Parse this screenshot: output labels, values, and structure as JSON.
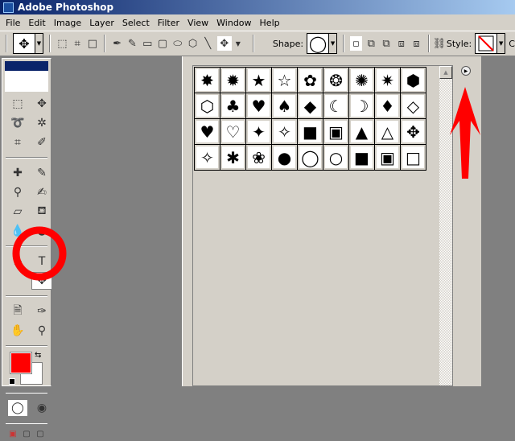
{
  "title": "Adobe Photoshop",
  "menu": [
    "File",
    "Edit",
    "Image",
    "Layer",
    "Select",
    "Filter",
    "View",
    "Window",
    "Help"
  ],
  "options": {
    "shape_label": "Shape:",
    "style_label": "Style:",
    "tail": "C"
  },
  "shapes": [
    "✸",
    "✹",
    "★",
    "☆",
    "✿",
    "❂",
    "✺",
    "✷",
    "⬢",
    "⬡",
    "♣",
    "♥",
    "♠",
    "◆",
    "☾",
    "☽",
    "♦",
    "◇",
    "♥",
    "♡",
    "✦",
    "✧",
    "■",
    "▣",
    "▲",
    "△",
    "✥",
    "✧",
    "✱",
    "❀",
    "●",
    "◯",
    "○",
    "■",
    "▣",
    "□"
  ],
  "colors": {
    "foreground": "#ff0000",
    "background": "#ffffff",
    "annotation": "#ff0000"
  }
}
